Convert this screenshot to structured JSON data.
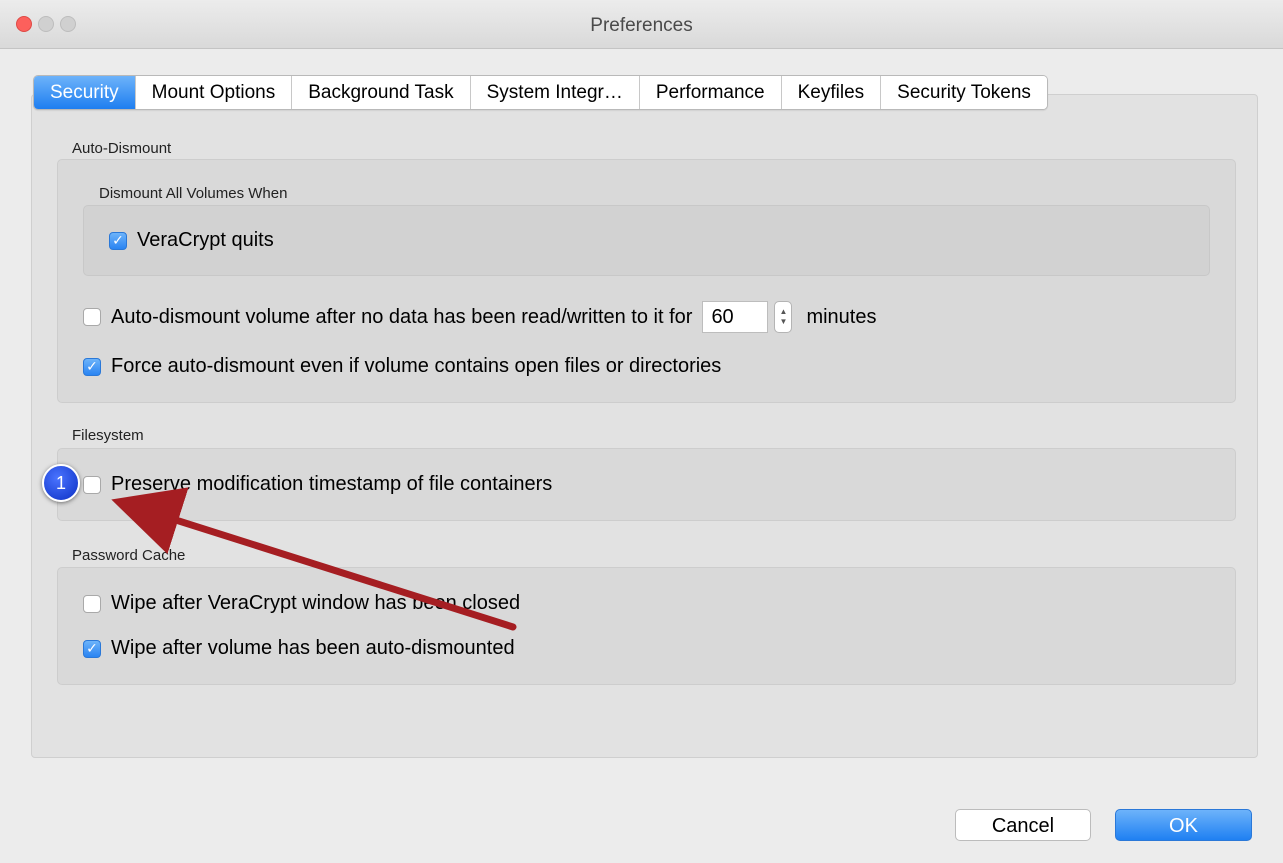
{
  "window": {
    "title": "Preferences"
  },
  "tabs": [
    {
      "label": "Security",
      "active": true
    },
    {
      "label": "Mount Options"
    },
    {
      "label": "Background Task"
    },
    {
      "label": "System Integr…"
    },
    {
      "label": "Performance"
    },
    {
      "label": "Keyfiles"
    },
    {
      "label": "Security Tokens"
    }
  ],
  "auto_dismount": {
    "title": "Auto-Dismount",
    "dismount_all": {
      "title": "Dismount All Volumes When",
      "veracrypt_quits": {
        "label": "VeraCrypt quits",
        "checked": true
      }
    },
    "auto_dismount_idle": {
      "label": "Auto-dismount volume after no data has been read/written to it for",
      "checked": false,
      "minutes_value": "60",
      "unit": "minutes"
    },
    "force_dismount": {
      "label": "Force auto-dismount even if volume contains open files or directories",
      "checked": true
    }
  },
  "filesystem": {
    "title": "Filesystem",
    "preserve_timestamp": {
      "label": "Preserve modification timestamp of file containers",
      "checked": false
    }
  },
  "password_cache": {
    "title": "Password Cache",
    "wipe_window_closed": {
      "label": "Wipe after VeraCrypt window has been closed",
      "checked": false
    },
    "wipe_auto_dismounted": {
      "label": "Wipe after volume has been auto-dismounted",
      "checked": true
    }
  },
  "buttons": {
    "cancel": "Cancel",
    "ok": "OK"
  },
  "annotation": {
    "number": "1",
    "color": "#1a3fe0",
    "arrow_color": "#a51e22"
  },
  "colors": {
    "accent": "#2a84f2",
    "close": "#fc605c"
  }
}
